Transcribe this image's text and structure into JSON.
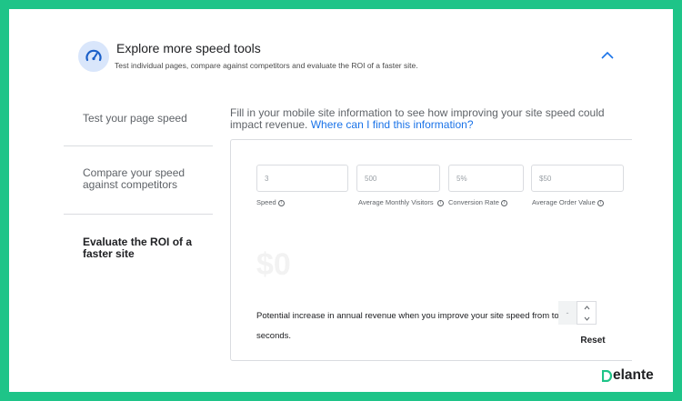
{
  "header": {
    "title": "Explore more speed tools",
    "subtitle": "Test individual pages, compare against competitors and evaluate the ROI of a faster site.",
    "icon": "speedometer-icon",
    "collapse_icon": "chevron-up-icon",
    "accent_color": "#1a73e8"
  },
  "sidebar": {
    "items": [
      {
        "label": "Test your page speed",
        "active": false
      },
      {
        "label": "Compare your speed against competitors",
        "active": false
      },
      {
        "label": "Evaluate the ROI of a faster site",
        "active": true
      }
    ]
  },
  "main": {
    "intro_text": "Fill in your mobile site information to see how improving your site speed could impact revenue.",
    "intro_link": "Where can I find this information?",
    "fields": [
      {
        "label": "Speed",
        "placeholder": "3"
      },
      {
        "label": "Average Monthly Visitors",
        "placeholder": "500"
      },
      {
        "label": "Conversion Rate",
        "placeholder": "5%"
      },
      {
        "label": "Average Order Value",
        "placeholder": "$50"
      }
    ],
    "result_value": "$0",
    "potential_text": "Potential increase in annual revenue when you improve your site speed from to seconds.",
    "stepper_value": "-",
    "reset_label": "Reset"
  },
  "brand": {
    "logo_text": "Delante",
    "frame_color": "#1ec488"
  }
}
